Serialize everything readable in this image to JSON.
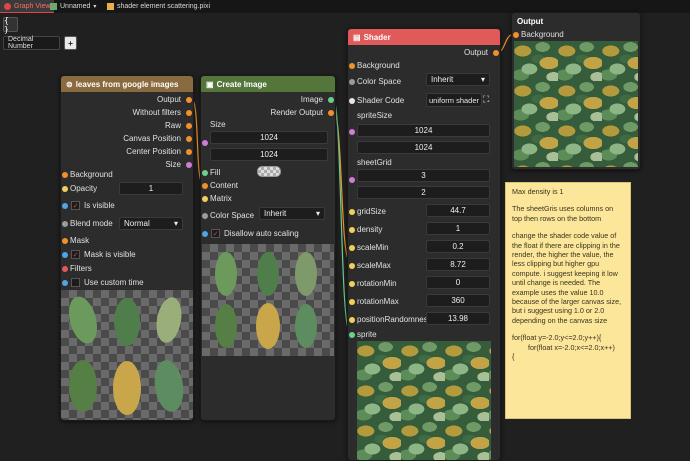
{
  "tabs": [
    {
      "label": "Graph View",
      "active": true
    },
    {
      "label": "Unnamed"
    },
    {
      "label": "shader element scattering.pixi"
    }
  ],
  "toolbar": {
    "braces_label": "{ }",
    "number_mode": "Decimal Number",
    "add_label": "+"
  },
  "colors": {
    "leaves_header": "#8a6a3f",
    "create_header": "#54763a",
    "shader_header": "#e05a5a",
    "accent": "#e04545"
  },
  "leaves_node": {
    "title": "leaves from google images",
    "outputs": [
      "Output",
      "Without filters",
      "Raw",
      "Canvas Position",
      "Center Position",
      "Size"
    ],
    "background_label": "Background",
    "opacity_label": "Opacity",
    "opacity_value": "1",
    "is_visible_label": "Is visible",
    "blend_mode_label": "Blend mode",
    "blend_mode_value": "Normal",
    "mask_label": "Mask",
    "mask_visible_label": "Mask is visible",
    "filters_label": "Filters",
    "custom_time_label": "Use custom time"
  },
  "create_node": {
    "title": "Create Image",
    "outputs": [
      "Image",
      "Render Output"
    ],
    "size_label": "Size",
    "size_w": "1024",
    "size_h": "1024",
    "fill_label": "Fill",
    "content_label": "Content",
    "matrix_label": "Matrix",
    "color_space_label": "Color Space",
    "color_space_value": "Inherit",
    "disallow_label": "Disallow auto scaling"
  },
  "shader_node": {
    "title": "Shader",
    "output_label": "Output",
    "background_label": "Background",
    "color_space_label": "Color Space",
    "color_space_value": "Inherit",
    "shader_code_label": "Shader Code",
    "shader_code_value": "uniform shader",
    "sprite_size_label": "spriteSize",
    "sprite_size_w": "1024",
    "sprite_size_h": "1024",
    "sheet_grid_label": "sheetGrid",
    "sheet_grid_x": "3",
    "sheet_grid_y": "2",
    "params": [
      {
        "label": "gridSize",
        "value": "44.7"
      },
      {
        "label": "density",
        "value": "1"
      },
      {
        "label": "scaleMin",
        "value": "0.2"
      },
      {
        "label": "scaleMax",
        "value": "8.72"
      },
      {
        "label": "rotationMin",
        "value": "0"
      },
      {
        "label": "rotationMax",
        "value": "360"
      },
      {
        "label": "positionRandomness",
        "value": "13.98"
      }
    ],
    "sprite_label": "sprite"
  },
  "output_node": {
    "title": "Output",
    "background_label": "Background"
  },
  "note": {
    "p1": "Max density is 1",
    "p2": "The sheetGris uses columns on top then rows on the bottom",
    "p3": "change the shader code value of the float if there are clipping in the render, the higher the value, the less clipping but higher gpu compute. i suggest keeping it low until change is needed. The example uses the value 10.0 because of the larger canvas size, but i suggest using 1.0 or 2.0 depending on the canvas size",
    "p4": "for(float y=-2.0;y<=2.0;y++){\n        for(float x=-2.0;x<=2.0;x++)\n{"
  }
}
